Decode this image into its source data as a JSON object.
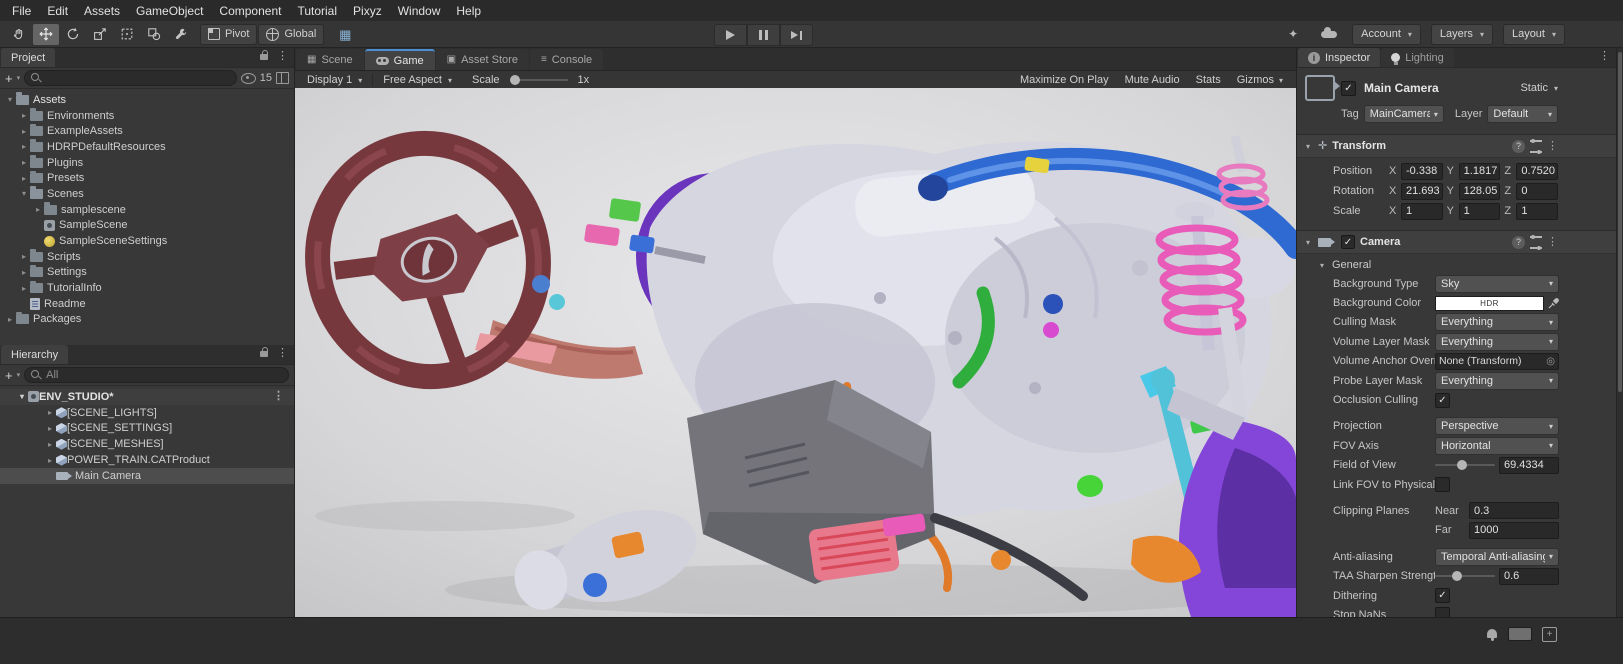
{
  "menubar": {
    "items": [
      "File",
      "Edit",
      "Assets",
      "GameObject",
      "Component",
      "Tutorial",
      "Pixyz",
      "Window",
      "Help"
    ]
  },
  "toolbar": {
    "pivot": "Pivot",
    "global": "Global",
    "account": "Account",
    "layers": "Layers",
    "layout": "Layout"
  },
  "project_panel": {
    "title": "Project",
    "item_count_badge": "15",
    "tree": [
      {
        "label": "Assets"
      },
      {
        "label": "Environments"
      },
      {
        "label": "ExampleAssets"
      },
      {
        "label": "HDRPDefaultResources"
      },
      {
        "label": "Plugins"
      },
      {
        "label": "Presets"
      },
      {
        "label": "Scenes"
      },
      {
        "label": "samplescene"
      },
      {
        "label": "SampleScene"
      },
      {
        "label": "SampleSceneSettings"
      },
      {
        "label": "Scripts"
      },
      {
        "label": "Settings"
      },
      {
        "label": "TutorialInfo"
      },
      {
        "label": "Readme"
      },
      {
        "label": "Packages"
      }
    ]
  },
  "hierarchy_panel": {
    "title": "Hierarchy",
    "search_value": "All",
    "items": [
      {
        "label": "ENV_STUDIO*"
      },
      {
        "label": "[SCENE_LIGHTS]"
      },
      {
        "label": "[SCENE_SETTINGS]"
      },
      {
        "label": "[SCENE_MESHES]"
      },
      {
        "label": "POWER_TRAIN.CATProduct"
      },
      {
        "label": "Main Camera"
      }
    ]
  },
  "game_view": {
    "tabs": [
      {
        "label": "Scene"
      },
      {
        "label": "Game"
      },
      {
        "label": "Asset Store"
      },
      {
        "label": "Console"
      }
    ],
    "display": "Display 1",
    "aspect": "Free Aspect",
    "scale_label": "Scale",
    "scale_value": "1x",
    "maximize_on_play": "Maximize On Play",
    "mute_audio": "Mute Audio",
    "stats": "Stats",
    "gizmos": "Gizmos"
  },
  "inspector": {
    "tabs": {
      "inspector": "Inspector",
      "lighting": "Lighting"
    },
    "header": {
      "name": "Main Camera",
      "static": "Static",
      "tag_label": "Tag",
      "tag_value": "MainCamera",
      "layer_label": "Layer",
      "layer_value": "Default"
    },
    "transform": {
      "title": "Transform",
      "axis_x": "X",
      "axis_y": "Y",
      "axis_z": "Z",
      "position": {
        "label": "Position",
        "x": "-0.338",
        "y": "1.1817",
        "z": "0.7520"
      },
      "rotation": {
        "label": "Rotation",
        "x": "21.693",
        "y": "128.05",
        "z": "0"
      },
      "scale": {
        "label": "Scale",
        "x": "1",
        "y": "1",
        "z": "1"
      }
    },
    "camera": {
      "title": "Camera",
      "section_general": "General",
      "background_type": {
        "label": "Background Type",
        "value": "Sky"
      },
      "background_color": {
        "label": "Background Color",
        "hdr": "HDR"
      },
      "culling_mask": {
        "label": "Culling Mask",
        "value": "Everything"
      },
      "volume_layer_mask": {
        "label": "Volume Layer Mask",
        "value": "Everything"
      },
      "volume_anchor": {
        "label": "Volume Anchor Override",
        "value": "None (Transform)"
      },
      "probe_layer_mask": {
        "label": "Probe Layer Mask",
        "value": "Everything"
      },
      "occlusion_culling": {
        "label": "Occlusion Culling",
        "checked": true
      },
      "projection": {
        "label": "Projection",
        "value": "Perspective"
      },
      "fov_axis": {
        "label": "FOV Axis",
        "value": "Horizontal"
      },
      "field_of_view": {
        "label": "Field of View",
        "value": "69.4334"
      },
      "link_fov": {
        "label": "Link FOV to Physical Camera",
        "checked": false
      },
      "clipping": {
        "label": "Clipping Planes",
        "near_label": "Near",
        "near_value": "0.3",
        "far_label": "Far",
        "far_value": "1000"
      },
      "anti_aliasing": {
        "label": "Anti-aliasing",
        "value": "Temporal Anti-aliasing (TAA)"
      },
      "taa_sharpen": {
        "label": "TAA Sharpen Strength",
        "value": "0.6"
      },
      "dithering": {
        "label": "Dithering",
        "checked": true
      },
      "stop_nans": {
        "label": "Stop NaNs",
        "checked": false
      }
    }
  },
  "colors": {
    "accent": "#4c8fd6",
    "selection": "#4d4d4d",
    "viewport_bg": "#d6d6d8",
    "purple_wheel": "#8446d8",
    "steering_wheel": "#76383d"
  }
}
